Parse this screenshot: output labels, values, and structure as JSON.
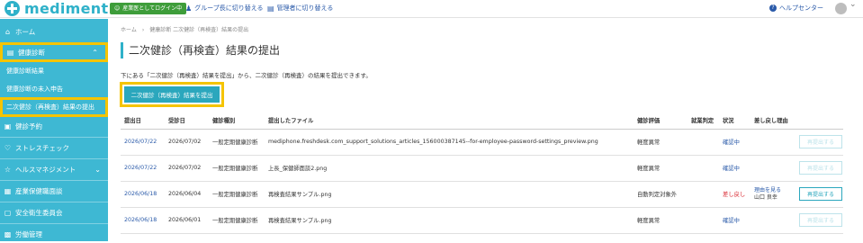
{
  "header": {
    "logo_text": "mediment",
    "login_badge": "産業医としてログイン中",
    "link_group": "グループ長に切り替える",
    "link_admin": "管理者に切り替える",
    "help": "ヘルプセンター"
  },
  "sidebar": {
    "home": "ホーム",
    "checkup": "健康診断",
    "checkup_results": "健康診断結果",
    "checkup_unreceived": "健康診断の未入申告",
    "secondary_submit": "二次健診（再検査）結果の提出",
    "checkup_booking": "健診予約",
    "stress_check": "ストレスチェック",
    "health_management": "ヘルスマネジメント",
    "occupational_health": "産業保健職面談",
    "safety_committee": "安全衛生委員会",
    "labor_management": "労働管理"
  },
  "main": {
    "breadcrumb": "ホーム　›　健康診断 二次健診（再検査）結果の提出",
    "title": "二次健診（再検査）結果の提出",
    "description": "下にある「二次健診（再検査）結果を提出」から、二次健診（再検査）の結果を提出できます。",
    "cta": "二次健診（再検査）結果を提出"
  },
  "table": {
    "headers": [
      "提出日",
      "受診日",
      "健診種別",
      "提出したファイル",
      "健診評価",
      "就業判定",
      "状況",
      "差し戻し理由",
      ""
    ],
    "rows": [
      {
        "submitted": "2026/07/22",
        "exam": "2026/07/02",
        "type": "一般定期健康診断",
        "file": "mediphone.freshdesk.com_support_solutions_articles_156000387145--for-employee-password-settings_preview.png",
        "eval": "軽度異常",
        "judgment": "",
        "status": "確認中",
        "reason": "",
        "reason_by": "",
        "button": "再提出する"
      },
      {
        "submitted": "2026/07/22",
        "exam": "2026/07/02",
        "type": "一般定期健康診断",
        "file": "上長_保健師面談2.png",
        "eval": "軽度異常",
        "judgment": "",
        "status": "確認中",
        "reason": "",
        "reason_by": "",
        "button": "再提出する"
      },
      {
        "submitted": "2026/06/18",
        "exam": "2026/06/04",
        "type": "一般定期健康診断",
        "file": "再検査結果サンプル.png",
        "eval": "自動判定対象外",
        "judgment": "",
        "status": "差し戻し",
        "reason": "理由を見る",
        "reason_by": "山口 良幸",
        "button": "再提出する"
      },
      {
        "submitted": "2026/06/18",
        "exam": "2026/06/01",
        "type": "一般定期健康診断",
        "file": "再検査結果サンプル.png",
        "eval": "軽度異常",
        "judgment": "",
        "status": "確認中",
        "reason": "",
        "reason_by": "",
        "button": "再提出する"
      }
    ]
  },
  "colors": {
    "brand": "#2fb1c9",
    "sidebar": "#3eb8d3",
    "highlight": "#f5c400",
    "link": "#2a5aa9",
    "danger": "#d9262f",
    "login_badge": "#3e9d3a"
  }
}
